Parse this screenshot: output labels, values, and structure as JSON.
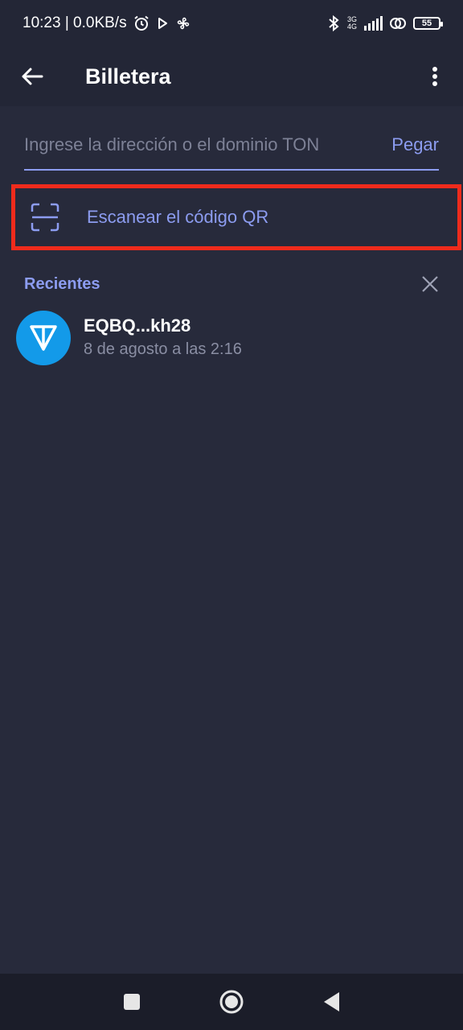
{
  "status_bar": {
    "time_speed": "10:23 | 0.0KB/s",
    "network_top": "3G",
    "network_bottom": "4G",
    "battery": "55",
    "icons": [
      "alarm-icon",
      "play-store-icon",
      "pinwheel-icon",
      "bluetooth-icon",
      "signal-icon",
      "hotspot-icon",
      "battery-icon"
    ]
  },
  "app_bar": {
    "title": "Billetera",
    "back_icon": "arrow-left-icon",
    "menu_icon": "more-vert-icon"
  },
  "address": {
    "value": "",
    "placeholder": "Ingrese la dirección o el dominio TON",
    "paste_label": "Pegar"
  },
  "scan": {
    "label": "Escanear el código QR",
    "icon": "qr-scan-icon",
    "highlight_color": "#ef2b1c"
  },
  "recents": {
    "title": "Recientes",
    "clear_icon": "close-icon",
    "items": [
      {
        "name": "EQBQ...kh28",
        "time": "8 de agosto a las 2:16",
        "icon": "ton-logo-icon"
      }
    ]
  },
  "nav_bar": {
    "icons": [
      "recents-square-icon",
      "home-circle-icon",
      "back-triangle-icon"
    ]
  },
  "colors": {
    "background": "#272a3b",
    "bar": "#232636",
    "accent": "#8c9cf0",
    "ton_blue": "#139ae9"
  }
}
